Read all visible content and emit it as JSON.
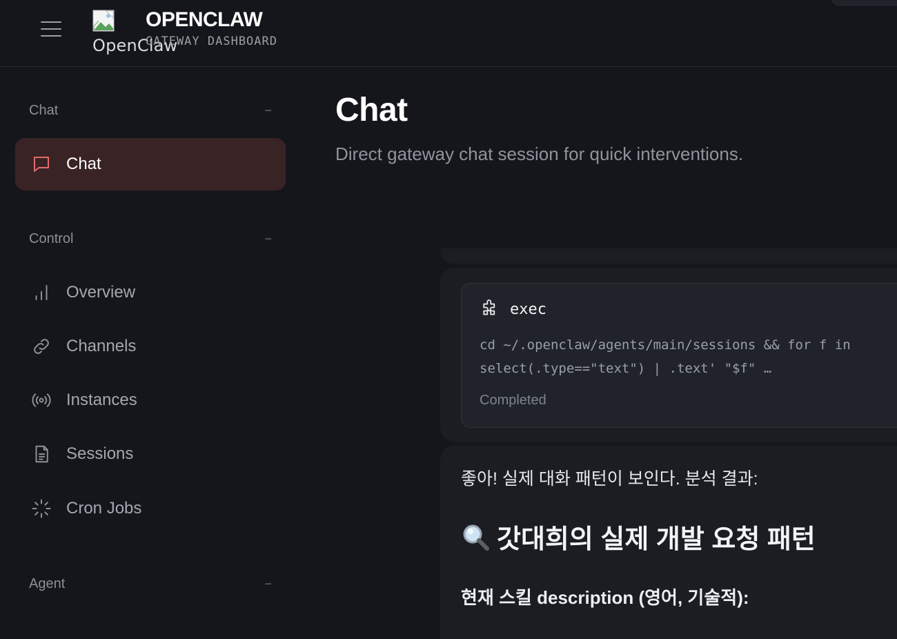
{
  "brand": {
    "logo_alt": "OpenClaw",
    "title": "OPENCLAW",
    "subtitle": "GATEWAY DASHBOARD"
  },
  "sidebar": {
    "groups": [
      {
        "label": "Chat",
        "collapse": "−"
      },
      {
        "label": "Control",
        "collapse": "−"
      },
      {
        "label": "Agent",
        "collapse": "−"
      }
    ],
    "items": [
      {
        "label": "Chat",
        "icon": "message-square-icon",
        "active": true
      },
      {
        "label": "Overview",
        "icon": "bar-chart-icon"
      },
      {
        "label": "Channels",
        "icon": "link-icon"
      },
      {
        "label": "Instances",
        "icon": "radio-icon"
      },
      {
        "label": "Sessions",
        "icon": "file-text-icon"
      },
      {
        "label": "Cron Jobs",
        "icon": "loader-icon"
      }
    ]
  },
  "main": {
    "title": "Chat",
    "subtitle": "Direct gateway chat session for quick interventions.",
    "tool_call": {
      "icon": "puzzle-icon",
      "name": "exec",
      "command_line1": "cd ~/.openclaw/agents/main/sessions && for f in",
      "command_line2": "select(.type==\"text\") | .text' \"$f\" …",
      "status": "Completed"
    },
    "reply": {
      "intro": "좋아! 실제 대화 패턴이 보인다. 분석 결과:",
      "heading_icon": "magnifier-icon",
      "heading": "갓대희의 실제 개발 요청 패턴",
      "subheading": "현재 스킬 description (영어, 기술적):"
    }
  }
}
